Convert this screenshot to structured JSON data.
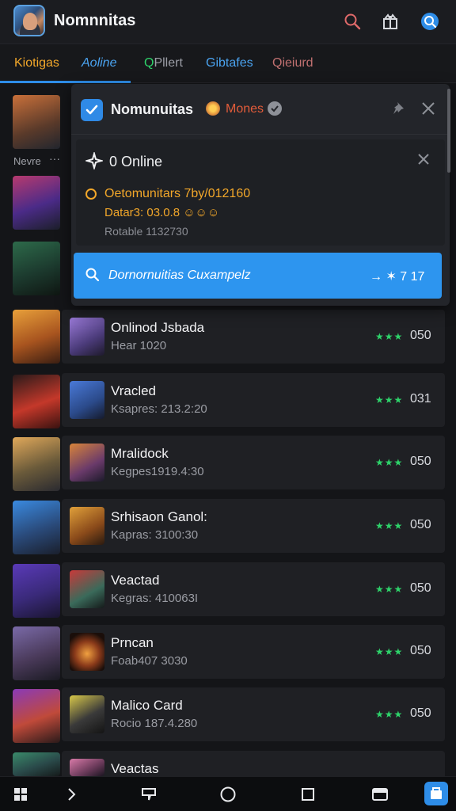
{
  "app": {
    "title": "Nomnnitas"
  },
  "tabs": [
    {
      "label": "Kiotigas",
      "color": "#f2a72a",
      "active": true
    },
    {
      "label": "Aoline",
      "color": "#4aa3f0",
      "active": false
    },
    {
      "label": "Pllert",
      "color": "#9c9ea6",
      "active": false
    },
    {
      "label": "Gibtafes",
      "color": "#4aa3f0",
      "active": false
    },
    {
      "label": "Qieiurd",
      "color": "#c07070",
      "active": false
    }
  ],
  "sidebar": {
    "label": "Nevre",
    "dots": "···"
  },
  "overlay": {
    "title": "Nomunuitas",
    "badge_text": "Mones",
    "online_label": "0 Online",
    "line1": "Oetomunitars 7by/012160",
    "line2": "Datar3: 03.0.8 ☺☺☺",
    "line3": "Rotable 1132730",
    "search_text": "Dornornuitias Cuxampelz",
    "search_right": "→ ✶ 7 17"
  },
  "rows": [
    {
      "title": "Onlinod Jsbada",
      "subtitle": "Hear 1020",
      "stars": "★★★",
      "score": "050"
    },
    {
      "title": "Vracled",
      "subtitle": "Ksapres: 213.2:20",
      "stars": "★★★",
      "score": "031"
    },
    {
      "title": "Mralidock",
      "subtitle": "Kegpes1919.4:30",
      "stars": "★★★",
      "score": "050"
    },
    {
      "title": "Srhisaon Ganol:",
      "subtitle": "Kapras: 3100:30",
      "stars": "★★★",
      "score": "050"
    },
    {
      "title": "Veactad",
      "subtitle": "Kegras: 410063I",
      "stars": "★★★",
      "score": "050"
    },
    {
      "title": "Prncan",
      "subtitle": "Foab407 3030",
      "stars": "★★★",
      "score": "050"
    },
    {
      "title": "Malico Card",
      "subtitle": "Rocio 187.4.280",
      "stars": "★★★",
      "score": "050"
    },
    {
      "title": "Veactas",
      "subtitle": "",
      "stars": "",
      "score": ""
    }
  ],
  "colors": {
    "accent": "#2e8de8",
    "star": "#2ed36a",
    "warning": "#f2a72a",
    "search_bar": "#2d95ef"
  }
}
